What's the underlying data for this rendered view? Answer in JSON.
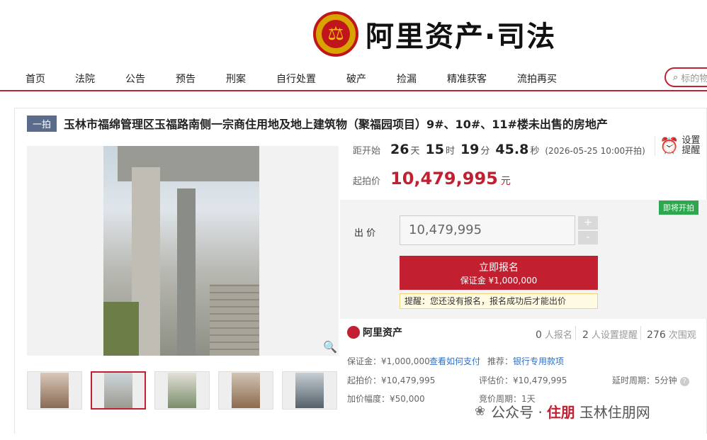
{
  "brand": {
    "title": "阿里资产·司法",
    "emblem_icon": "court-emblem-icon"
  },
  "nav": {
    "items": [
      "首页",
      "法院",
      "公告",
      "预告",
      "刑案",
      "自行处置",
      "破产",
      "捡漏",
      "精准获客",
      "流拍再买"
    ],
    "search_placeholder": "标的物"
  },
  "auction": {
    "badge": "一拍",
    "title": "玉林市福绵管理区玉福路南侧一宗商住用地及地上建筑物（聚福园项目）9#、10#、11#楼未出售的房地产",
    "countdown_label": "距开始",
    "days": "26",
    "days_unit": "天",
    "hours": "15",
    "hours_unit": "时",
    "minutes": "19",
    "minutes_unit": "分",
    "seconds": "45.8",
    "seconds_unit": "秒",
    "start_note": "(2026-05-25 10:00开拍)",
    "remind_label": "设置\n提醒",
    "start_price_label": "起拍价",
    "start_price": "10,479,995",
    "currency_unit": "元",
    "soon_badge": "即将开拍",
    "bid_label": "出  价",
    "bid_value": "10,479,995",
    "plus": "+",
    "minus": "-",
    "apply_label": "立即报名",
    "apply_deposit": "保证金 ¥1,000,000",
    "tip": "提醒：您还没有报名，报名成功后才能出价",
    "platform": "阿里资产",
    "signups_num": "0",
    "signups_label": "人报名",
    "reminders_num": "2",
    "reminders_label": "人设置提醒",
    "views_num": "276",
    "views_label": "次围观"
  },
  "details": {
    "deposit": "保证金：¥1,000,000",
    "how_pay": "查看如何支付",
    "recommend_label": "推荐：",
    "recommend_link": "银行专用款项",
    "start_price": "起拍价：¥10,479,995",
    "appraisal": "评估价：¥10,479,995",
    "delay": "延时周期：5分钟",
    "increment": "加价幅度：¥50,000",
    "period": "竞价周期：1天"
  },
  "watermark": {
    "text1": "公众号 ·",
    "logo": "住朋",
    "text2": "玉林住朋网"
  },
  "colors": {
    "accent": "#c21f30",
    "badge": "#5a6b8c",
    "soon": "#2ea84f",
    "link": "#2d6fc9"
  }
}
